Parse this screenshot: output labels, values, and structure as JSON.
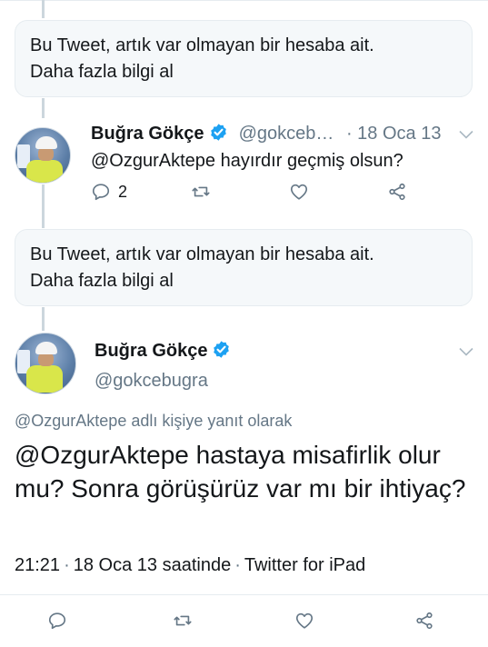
{
  "notice1": {
    "line1": "Bu Tweet, artık var olmayan bir hesaba ait.",
    "line2": "Daha fazla bilgi al"
  },
  "tweet1": {
    "name": "Buğra Gökçe",
    "handle": "@gokceb…",
    "time": "· 18 Oca 13",
    "text": "@OzgurAktepe hayırdır geçmiş olsun?",
    "reply_count": "2"
  },
  "notice2": {
    "line1": "Bu Tweet, artık var olmayan bir hesaba ait.",
    "line2": "Daha fazla bilgi al"
  },
  "main_tweet": {
    "name": "Buğra Gökçe",
    "handle": "@gokcebugra",
    "reply_context": "@OzgurAktepe adlı kişiye yanıt olarak",
    "text": "@OzgurAktepe hastaya misafirlik olur mu? Sonra görüşürüz var mı bir ihtiyaç?",
    "time": "21:21",
    "date": "18 Oca 13 saatinde",
    "source": "Twitter for iPad"
  },
  "icons": {
    "reply": "reply-icon",
    "retweet": "retweet-icon",
    "like": "like-icon",
    "share": "share-icon",
    "verified": "verified-badge-icon",
    "more": "chevron-down-icon"
  },
  "colors": {
    "verified": "#1da1f2",
    "muted": "#657786",
    "text": "#14171a",
    "notice_bg": "#f5f8fa"
  }
}
